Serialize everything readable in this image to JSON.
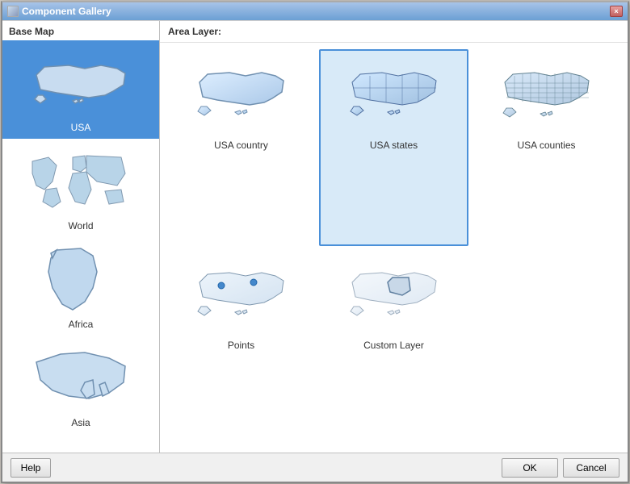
{
  "window": {
    "title": "Component Gallery",
    "close_label": "×"
  },
  "sidebar": {
    "header": "Base Map",
    "items": [
      {
        "id": "usa",
        "label": "USA",
        "selected": true
      },
      {
        "id": "world",
        "label": "World",
        "selected": false
      },
      {
        "id": "africa",
        "label": "Africa",
        "selected": false
      },
      {
        "id": "asia",
        "label": "Asia",
        "selected": false
      }
    ]
  },
  "main": {
    "header": "Area Layer:",
    "items": [
      {
        "id": "usa-country",
        "label": "USA country",
        "selected": false
      },
      {
        "id": "usa-states",
        "label": "USA states",
        "selected": true
      },
      {
        "id": "usa-counties",
        "label": "USA counties",
        "selected": false
      },
      {
        "id": "points",
        "label": "Points",
        "selected": false
      },
      {
        "id": "custom-layer",
        "label": "Custom Layer",
        "selected": false
      }
    ]
  },
  "footer": {
    "help_label": "Help",
    "ok_label": "OK",
    "cancel_label": "Cancel"
  }
}
